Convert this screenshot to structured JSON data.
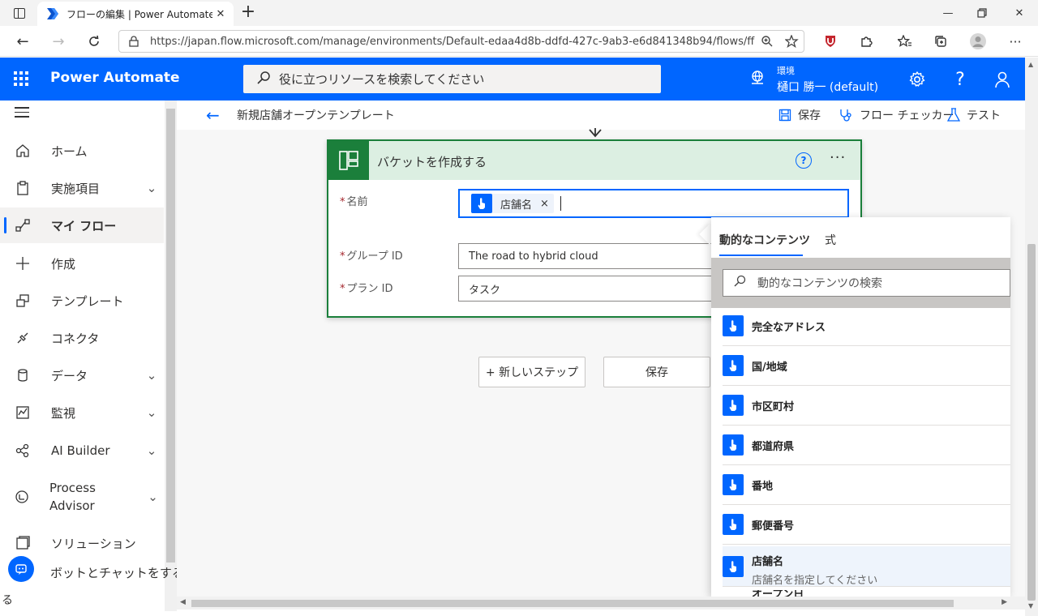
{
  "browser": {
    "tab_title": "フローの編集 | Power Automate",
    "url": "https://japan.flow.microsoft.com/manage/environments/Default-edaa4d8b-ddfd-427c-9ab3-e6d841348b94/flows/ff..."
  },
  "header": {
    "brand": "Power Automate",
    "search_placeholder": "役に立つリソースを検索してください",
    "env_label": "環境",
    "env_name": "樋口 勝一 (default)"
  },
  "sidebar": {
    "items": [
      {
        "label": "ホーム",
        "icon": "home-icon"
      },
      {
        "label": "実施項目",
        "icon": "clipboard-icon",
        "has_chevron": true
      },
      {
        "label": "マイ フロー",
        "icon": "flow-icon",
        "active": true
      },
      {
        "label": "作成",
        "icon": "plus-icon"
      },
      {
        "label": "テンプレート",
        "icon": "template-icon"
      },
      {
        "label": "コネクタ",
        "icon": "connector-icon"
      },
      {
        "label": "データ",
        "icon": "database-icon",
        "has_chevron": true
      },
      {
        "label": "監視",
        "icon": "monitor-icon",
        "has_chevron": true
      },
      {
        "label": "AI Builder",
        "icon": "ai-builder-icon",
        "has_chevron": true
      },
      {
        "label": "Process Advisor",
        "icon": "process-advisor-icon",
        "has_chevron": true
      },
      {
        "label": "ソリューション",
        "icon": "solution-icon"
      }
    ],
    "chatbot_label": "ボットとチャットをする",
    "chatbot_overflow": "る"
  },
  "commandbar": {
    "flow_name": "新規店舗オープンテンプレート",
    "save_label": "保存",
    "checker_label": "フロー チェッカー",
    "test_label": "テスト"
  },
  "action_card": {
    "title": "バケットを作成する",
    "help": "?",
    "fields": {
      "name_label": "名前",
      "name_token": "店舗名",
      "group_label": "グループ ID",
      "group_value": "The road to hybrid cloud",
      "plan_label": "プラン ID",
      "plan_value": "タスク"
    }
  },
  "buttons": {
    "new_step": "+ 新しいステップ",
    "save": "保存"
  },
  "dynamic_panel": {
    "tab_dynamic": "動的なコンテンツ",
    "tab_expression": "式",
    "search_placeholder": "動的なコンテンツの検索",
    "items": [
      {
        "label": "完全なアドレス"
      },
      {
        "label": "国/地域"
      },
      {
        "label": "市区町村"
      },
      {
        "label": "都道府県"
      },
      {
        "label": "番地"
      },
      {
        "label": "郵便番号"
      }
    ],
    "selected_item": {
      "label": "店舗名",
      "description": "店舗名を指定してください"
    },
    "cut_item": "オープン日"
  },
  "colors": {
    "brand_blue": "#0066ff",
    "planner_green": "#1b7f3b"
  }
}
